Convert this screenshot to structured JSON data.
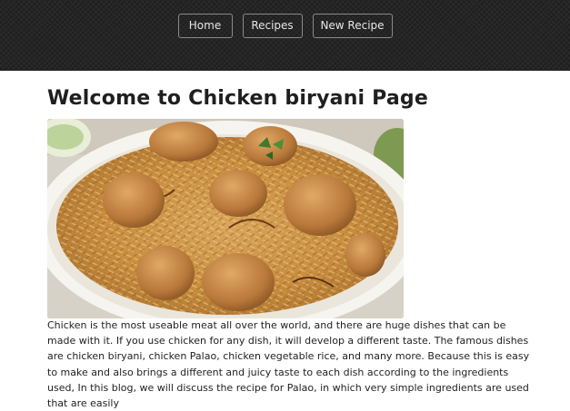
{
  "nav": {
    "items": [
      {
        "label": "Home"
      },
      {
        "label": "Recipes"
      },
      {
        "label": "New Recipe"
      }
    ]
  },
  "page": {
    "title": "Welcome to Chicken biryani Page",
    "image_subject": "chicken-biryani-photo",
    "body": "Chicken is the most useable meat all over the world, and there are huge dishes that can be made with it. If you use chicken for any dish, it will develop a different taste. The famous dishes are chicken biryani, chicken Palao, chicken vegetable rice, and many more. Because this is easy to make and also brings a different and juicy taste to each dish according to the ingredients used, In this blog, we will discuss the recipe for Palao, in which very simple ingredients are used that are easily"
  },
  "colors": {
    "header_bg": "#252525",
    "nav_border": "#8a8a8a",
    "title_text": "#1f1f1f",
    "body_text": "#222222"
  }
}
